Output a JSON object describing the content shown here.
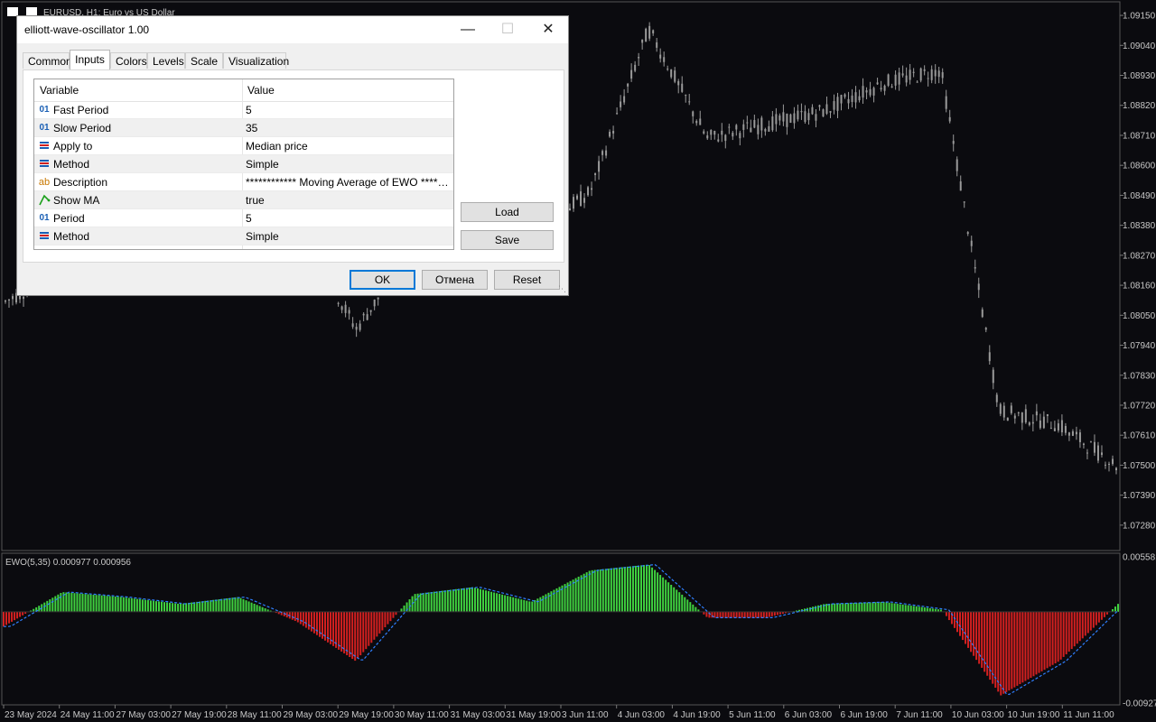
{
  "chart": {
    "symbol_label": "EURUSD, H1:  Euro vs US Dollar",
    "indicator_label": "EWO(5,35) 0.000977 0.000956",
    "price_ticks": [
      "1.09150",
      "1.09040",
      "1.08930",
      "1.08820",
      "1.08710",
      "1.08600",
      "1.08490",
      "1.08380",
      "1.08270",
      "1.08160",
      "1.08050",
      "1.07940",
      "1.07830",
      "1.07720",
      "1.07610",
      "1.07500",
      "1.07390",
      "1.07280"
    ],
    "osc_ticks": [
      "0.005581",
      "-0.009274"
    ],
    "time_ticks": [
      "23 May 2024",
      "24 May 11:00",
      "27 May 03:00",
      "27 May 19:00",
      "28 May 11:00",
      "29 May 03:00",
      "29 May 19:00",
      "30 May 11:00",
      "31 May 03:00",
      "31 May 19:00",
      "3 Jun 11:00",
      "4 Jun 03:00",
      "4 Jun 19:00",
      "5 Jun 11:00",
      "6 Jun 03:00",
      "6 Jun 19:00",
      "7 Jun 11:00",
      "10 Jun 03:00",
      "10 Jun 19:00",
      "11 Jun 11:00"
    ],
    "colors": {
      "background": "#0b0b0f",
      "candle": "#9a9a9a",
      "osc_up": "#3fd13f",
      "osc_down": "#d42020",
      "signal": "#2f7fff",
      "text": "#c8c8c8"
    }
  },
  "chart_data": {
    "type": "line",
    "title": "EURUSD, H1:  Euro vs US Dollar",
    "xlabel": "",
    "ylabel": "",
    "ylim": [
      1.0722,
      1.0918
    ],
    "x": [
      "23 May 2024",
      "24 May 11:00",
      "27 May 03:00",
      "27 May 19:00",
      "28 May 11:00",
      "29 May 03:00",
      "29 May 19:00",
      "30 May 11:00",
      "31 May 03:00",
      "31 May 19:00",
      "3 Jun 11:00",
      "4 Jun 03:00",
      "4 Jun 19:00",
      "5 Jun 11:00",
      "6 Jun 03:00",
      "6 Jun 19:00",
      "7 Jun 11:00",
      "10 Jun 03:00",
      "10 Jun 19:00",
      "11 Jun 11:00"
    ],
    "price": [
      1.081,
      1.0822,
      1.0845,
      1.0848,
      1.085,
      1.0838,
      1.08,
      1.083,
      1.0838,
      1.0835,
      1.085,
      1.091,
      1.087,
      1.0875,
      1.088,
      1.089,
      1.0895,
      1.077,
      1.0765,
      1.075
    ],
    "oscillator": {
      "name": "EWO(5,35) 0.000977 0.000956",
      "ylim": [
        -0.009274,
        0.005581
      ],
      "values": [
        -0.0015,
        0.002,
        0.0015,
        0.0008,
        0.0015,
        -0.001,
        -0.005,
        0.0018,
        0.0025,
        0.001,
        0.0042,
        0.0048,
        -0.0006,
        -0.0006,
        0.0008,
        0.001,
        0.0002,
        -0.0085,
        -0.005,
        0.0008
      ]
    }
  },
  "dialog": {
    "title": "elliott-wave-oscillator 1.00",
    "tabs": [
      "Common",
      "Inputs",
      "Colors",
      "Levels",
      "Scale",
      "Visualization"
    ],
    "active_tab": "Inputs",
    "columns": {
      "variable": "Variable",
      "value": "Value"
    },
    "rows": [
      {
        "icon": "int-icon",
        "variable": "Fast Period",
        "value": "5"
      },
      {
        "icon": "int-icon",
        "variable": "Slow Period",
        "value": "35"
      },
      {
        "icon": "enum-icon",
        "variable": "Apply to",
        "value": "Median price"
      },
      {
        "icon": "enum-icon",
        "variable": "Method",
        "value": "Simple"
      },
      {
        "icon": "string-icon",
        "variable": "Description",
        "value": "************ Moving Average of EWO ************"
      },
      {
        "icon": "bool-icon",
        "variable": "Show MA",
        "value": "true"
      },
      {
        "icon": "int-icon",
        "variable": "Period",
        "value": "5"
      },
      {
        "icon": "enum-icon",
        "variable": "Method",
        "value": "Simple"
      }
    ],
    "buttons": {
      "load": "Load",
      "save": "Save",
      "ok": "OK",
      "cancel": "Отмена",
      "reset": "Reset"
    }
  }
}
